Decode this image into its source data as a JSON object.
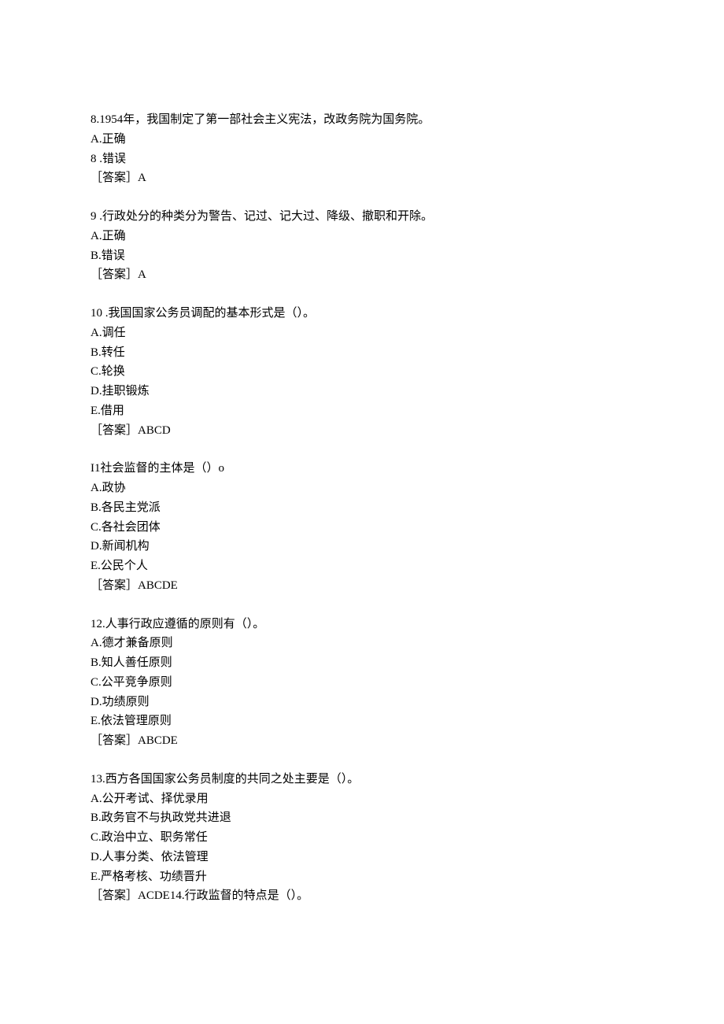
{
  "questions": [
    {
      "stem": "8.1954年，我国制定了第一部社会主义宪法，改政务院为国务院。",
      "options": [
        "A.正确",
        "8 .错误"
      ],
      "answer": "［答案］A"
    },
    {
      "stem": "9 .行政处分的种类分为警告、记过、记大过、降级、撤职和开除。",
      "options": [
        "A.正确",
        "B.错误"
      ],
      "answer": "［答案］A"
    },
    {
      "stem": "10 .我国国家公务员调配的基本形式是（）。",
      "options": [
        "A.调任",
        "B.转任",
        "C.轮换",
        "D.挂职锻炼",
        "E.借用"
      ],
      "answer": "［答案］ABCD"
    },
    {
      "stem": "I1社会监督的主体是（）o",
      "options": [
        "A.政协",
        "B.各民主党派",
        "C.各社会团体",
        "D.新闻机构",
        "E.公民个人"
      ],
      "answer": "［答案］ABCDE"
    },
    {
      "stem": "12.人事行政应遵循的原则有（）。",
      "options": [
        "A.德才兼备原则",
        "B.知人善任原则",
        "C.公平竞争原则",
        "D.功绩原则",
        "E.依法管理原则"
      ],
      "answer": "［答案］ABCDE"
    },
    {
      "stem": "13.西方各国国家公务员制度的共同之处主要是（）。",
      "options": [
        "A.公开考试、择优录用",
        "B.政务官不与执政党共进退",
        "C.政治中立、职务常任",
        "D.人事分类、依法管理",
        "E.严格考核、功绩晋升"
      ],
      "answer": "［答案］ACDE14.行政监督的特点是（）。"
    }
  ]
}
